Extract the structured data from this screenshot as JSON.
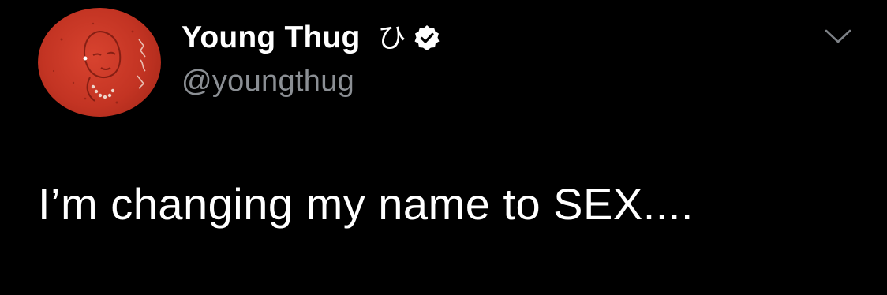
{
  "tweet": {
    "author": {
      "display_name": "Young Thug",
      "name_emoji": "ひ",
      "handle": "@youngthug",
      "verified": true
    },
    "text": "I’m changing my name to SEX....",
    "icons": {
      "verified": "verified-badge-icon",
      "menu": "chevron-down-icon"
    },
    "colors": {
      "background": "#000000",
      "text": "#ffffff",
      "handle": "#8b8f94",
      "avatar_red": "#c33423"
    }
  }
}
